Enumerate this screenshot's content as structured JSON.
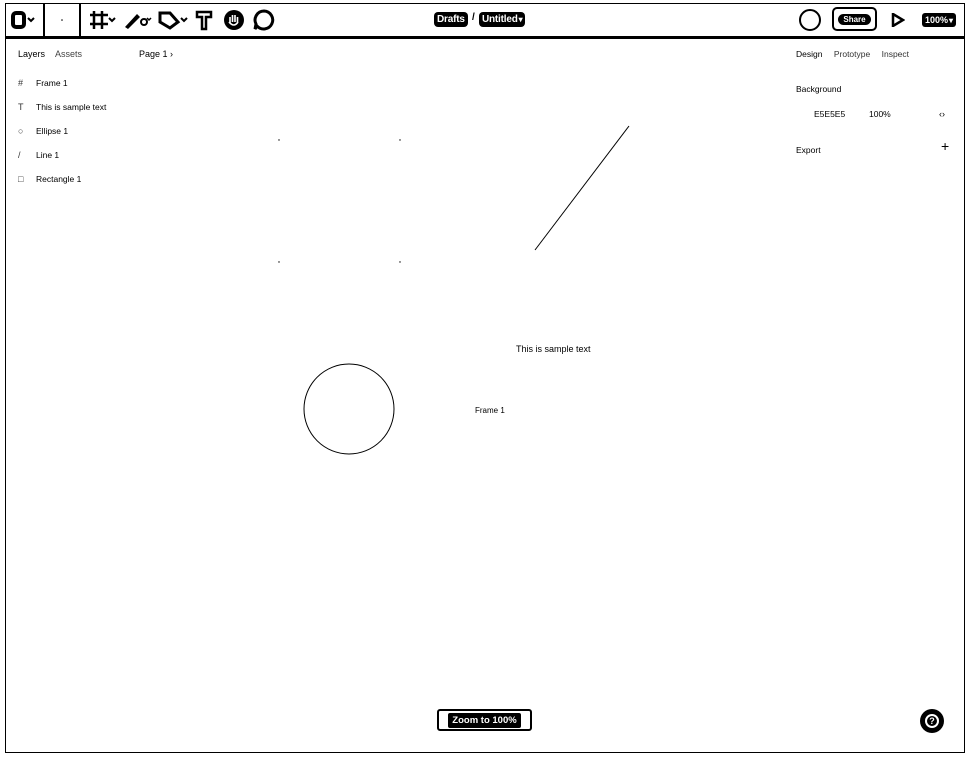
{
  "toolbar": {
    "tools": [
      {
        "name": "main-menu",
        "icon": "grid-menu-icon"
      },
      {
        "name": "move-tool",
        "icon": "cursor-icon"
      },
      {
        "name": "frame-tool",
        "icon": "frame-icon"
      },
      {
        "name": "pen-tool",
        "icon": "pen-icon"
      },
      {
        "name": "shape-tool",
        "icon": "shape-icon"
      },
      {
        "name": "text-tool",
        "icon": "text-icon"
      },
      {
        "name": "hand-tool",
        "icon": "hand-icon"
      },
      {
        "name": "comment-tool",
        "icon": "comment-icon"
      }
    ],
    "breadcrumb_folder": "Drafts",
    "breadcrumb_sep": "/",
    "file_name": "Untitled",
    "share_label": "Share",
    "zoom_level": "100%"
  },
  "left_panel": {
    "tab_layers": "Layers",
    "tab_assets": "Assets",
    "page_selector": "Page 1",
    "layers": [
      {
        "icon": "#",
        "label": "Frame 1"
      },
      {
        "icon": "T",
        "label": "This is sample text"
      },
      {
        "icon": "○",
        "label": "Ellipse 1"
      },
      {
        "icon": "/",
        "label": "Line 1"
      },
      {
        "icon": "□",
        "label": "Rectangle 1"
      }
    ]
  },
  "right_panel": {
    "tab_design": "Design",
    "tab_prototype": "Prototype",
    "tab_inspect": "Inspect",
    "background_label": "Background",
    "background_hex": "E5E5E5",
    "background_opacity": "100%",
    "export_label": "Export"
  },
  "canvas": {
    "text_object": "This is sample text",
    "frame_label": "Frame 1"
  },
  "footer": {
    "zoom_button": "Zoom to 100%",
    "help_label": "?"
  }
}
